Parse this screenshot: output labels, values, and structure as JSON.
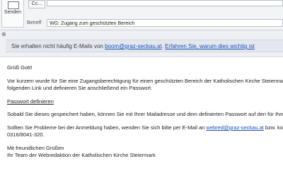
{
  "compose": {
    "send_label": "Senden",
    "cc_label": "Cc...",
    "subject_label": "Betreff",
    "subject_value": "WG: Zugang zum geschützten Bereich"
  },
  "info_bar": {
    "text": "Sie erhalten nicht häufig E-Mails von ",
    "email": "boom@graz-seckau.at",
    "sep": ". ",
    "learn_link": "Erfahren Sie, warum dies wichtig ist"
  },
  "body": {
    "greeting": "Grüß Gott!",
    "line1": "Vor kurzem wurde für Sie eine Zugangsberechtigung für einen geschützten Bereich der Katholischen Kirche Steiermark a",
    "line2": "folgenden Link und definieren Sie anschließend ein Passwort.",
    "password_link": "Passwort definieren",
    "line3": "Sobald Sie dieses gespeichert haben, können Sie mit Ihrer Mailadresse und dem definierten Passwort auf den für Ihre",
    "line4_pre": "Sollten Sie Probleme bei der Anmeldung haben, wenden Sie sich bitte per E-Mail an ",
    "line4_email": "webred@graz-seckau.at",
    "line4_post": " bzw. kon",
    "line5": "0316/8041-320.",
    "closing1": "Mit freundlichen Grüßen",
    "closing2": "Ihr Team der Webredaktion der Katholischen Kirche Steiermark"
  },
  "colors": {
    "link": "#1a4fb8",
    "info_bar_bg": "#e4e8ee"
  }
}
